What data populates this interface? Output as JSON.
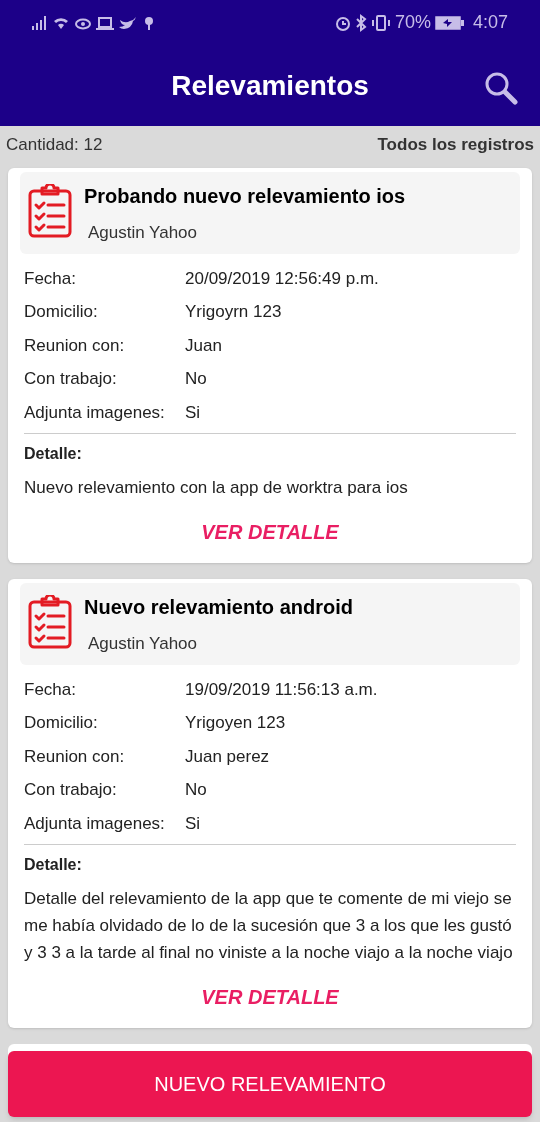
{
  "status_bar": {
    "battery": "70%",
    "time": "4:07"
  },
  "app_bar": {
    "title": "Relevamientos"
  },
  "summary": {
    "count": "Cantidad: 12",
    "filter": "Todos los registros"
  },
  "cards": [
    {
      "title": "Probando nuevo relevamiento ios",
      "author": "Agustin Yahoo",
      "fields": [
        {
          "label": "Fecha:",
          "value": "20/09/2019 12:56:49 p.m."
        },
        {
          "label": "Domicilio:",
          "value": "Yrigoyrn 123"
        },
        {
          "label": "Reunion con:",
          "value": "Juan"
        },
        {
          "label": "Con trabajo:",
          "value": "No"
        },
        {
          "label": "Adjunta imagenes:",
          "value": "Si"
        }
      ],
      "detail_label": "Detalle:",
      "detail": "Nuevo relevamiento con la app de worktra para ios",
      "action": "VER DETALLE"
    },
    {
      "title": "Nuevo relevamiento android",
      "author": "Agustin Yahoo",
      "fields": [
        {
          "label": "Fecha:",
          "value": "19/09/2019 11:56:13 a.m."
        },
        {
          "label": "Domicilio:",
          "value": "Yrigoyen 123"
        },
        {
          "label": "Reunion con:",
          "value": "Juan perez"
        },
        {
          "label": "Con trabajo:",
          "value": "No"
        },
        {
          "label": "Adjunta imagenes:",
          "value": "Si"
        }
      ],
      "detail_label": "Detalle:",
      "detail": "Detalle del relevamiento de la app que te comente de mi viejo se me había olvidado de lo de la sucesión que 3 a los que les gustó y 3 3 a la tarde al final no viniste a la noche viajo a la noche viajo",
      "action": "VER DETALLE"
    }
  ],
  "primary_button": "NUEVO RELEVAMIENTO"
}
